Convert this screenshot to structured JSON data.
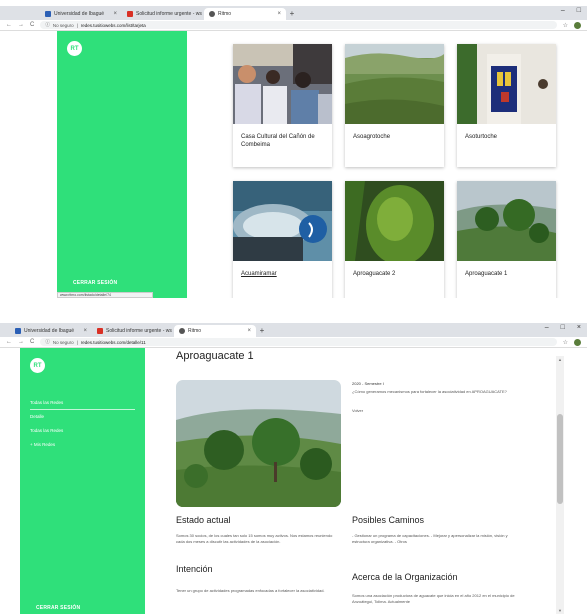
{
  "browser": {
    "tabs": [
      "Universidad de Ibagué",
      "Solicitud informe urgente - ws",
      "Ritmo"
    ],
    "new_tab": "+",
    "win_controls": [
      "–",
      "□",
      "×"
    ],
    "nav_back": "←",
    "nav_forward": "→",
    "nav_reload": "C",
    "security": "No seguro",
    "url_shot1": "redes.tusitiowebs.com/list/tarjeta",
    "url_shot2": "redes.tusitiowebs.com/detalle/11"
  },
  "sidebar": {
    "logo": "RT",
    "logout": "CERRAR SESIÓN",
    "status_url": "www.ritmo.com/listado/detalle/74",
    "menu": [
      "Todas las Redes",
      "Detalle",
      "Todas las Redes",
      "+ Mis Redes"
    ]
  },
  "cards": [
    {
      "label": "Casa Cultural del Cañón de Combeima",
      "link": false
    },
    {
      "label": "Asoagrotoche",
      "link": false
    },
    {
      "label": "Asoturtoche",
      "link": false
    },
    {
      "label": "Acuamiramar",
      "link": true
    },
    {
      "label": "Aproaguacate 2",
      "link": false
    },
    {
      "label": "Aproaguacate 1",
      "link": false
    }
  ],
  "detail": {
    "title": "Aproaguacate 1",
    "side_meta": "2020 - Semestre I",
    "side_question": "¿Cómo generamos mecanismos para fortalecer la asociatividad en APROAGUACATE?",
    "side_link": "Volver",
    "estado_title": "Estado actual",
    "estado_text": "Somos 30 socios, de los cuales tan solo 15 somos muy activos. Nos estamos reuniendo cada dos meses a discutir las actividades de la asociación.",
    "intencion_title": "Intención",
    "intencion_text": "Tener un grupo de actividades programadas enfocadas a fortalecer la asociatividad.",
    "caminos_title": "Posibles Caminos",
    "caminos_text": "- Gestionar un programa de capacitaciones. - Mejorar y apersonalizar la misión, visión y estructura organizativa. - Otros",
    "acerca_title": "Acerca de la Organización",
    "acerca_text": "Somos una asociación productora de aguacate que inicia en el año 2012 en el municipio de Anzoátegui, Tolima. Actualmente"
  },
  "colors": {
    "sidebar": "#2fe07a",
    "tabbar": "#dee1e6"
  }
}
